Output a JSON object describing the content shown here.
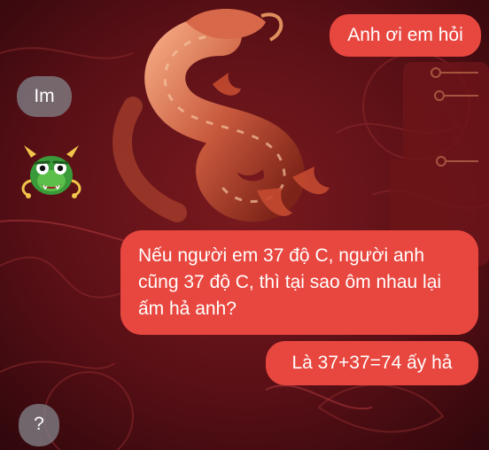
{
  "messages": [
    {
      "side": "sent",
      "text": "Anh ơi em hỏi"
    },
    {
      "side": "received",
      "text": "Im"
    },
    {
      "side": "sent",
      "text": "Nếu người em 37 độ C, người anh cũng 37 độ C, thì tại sao ôm nhau lại ấm hả anh?"
    },
    {
      "side": "sent",
      "text": "Là 37+37=74 ấy hả"
    },
    {
      "side": "received",
      "text": "?"
    }
  ],
  "avatar": {
    "icon": "dragon-emoji-icon"
  },
  "colors": {
    "sent_bubble": "#e8473f",
    "received_bubble": "#808086",
    "background": "#4a0d12",
    "dragon_accent": "#e0704a"
  }
}
